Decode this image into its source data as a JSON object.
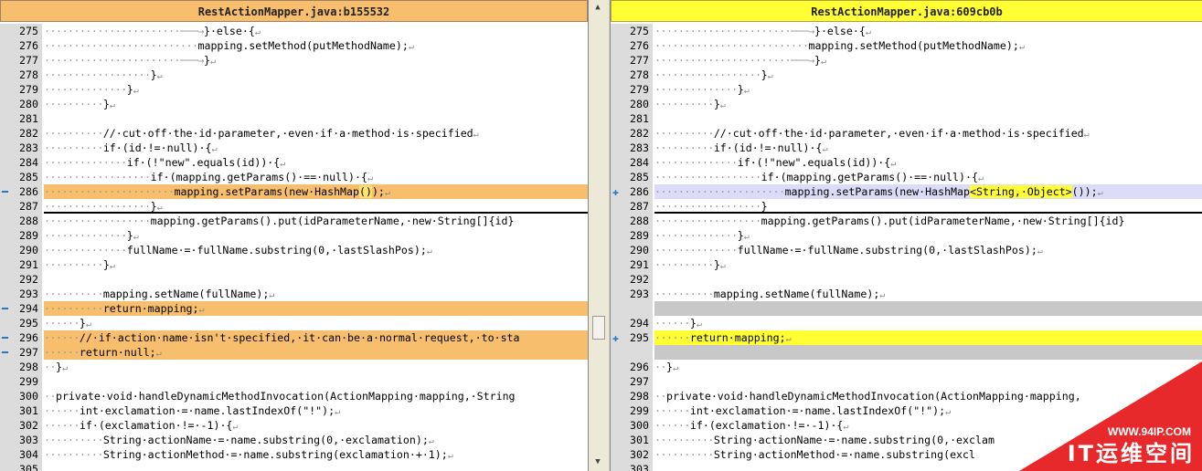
{
  "left": {
    "title": "RestActionMapper.java:b155532",
    "rows": [
      {
        "n": "275",
        "d": "·······················───→",
        "t": "}·else·{",
        "r": "↵",
        "s": "",
        "m": ""
      },
      {
        "n": "276",
        "d": "··························",
        "t": "mapping.setMethod(putMethodName);",
        "r": "↵",
        "s": "",
        "m": ""
      },
      {
        "n": "277",
        "d": "·······················───→",
        "t": "}",
        "r": "↵",
        "s": "",
        "m": ""
      },
      {
        "n": "278",
        "d": "··················",
        "t": "}",
        "r": "↵",
        "s": "",
        "m": ""
      },
      {
        "n": "279",
        "d": "··············",
        "t": "}",
        "r": "↵",
        "s": "",
        "m": ""
      },
      {
        "n": "280",
        "d": "··········",
        "t": "}",
        "r": "↵",
        "s": "",
        "m": ""
      },
      {
        "n": "281",
        "d": "",
        "t": "",
        "r": "",
        "s": "",
        "m": ""
      },
      {
        "n": "282",
        "d": "··········",
        "t": "//·cut·off·the·id·parameter,·even·if·a·method·is·specified",
        "r": "↵",
        "s": "",
        "m": ""
      },
      {
        "n": "283",
        "d": "··········",
        "t": "if·(id·!=·null)·{",
        "r": "↵",
        "s": "",
        "m": ""
      },
      {
        "n": "284",
        "d": "··············",
        "t": "if·(!\"new\".equals(id))·{",
        "r": "↵",
        "s": "",
        "m": ""
      },
      {
        "n": "285",
        "d": "··················",
        "t": "if·(mapping.getParams()·==·null)·{",
        "r": "↵",
        "s": "",
        "m": ""
      },
      {
        "n": "286",
        "d": "······················",
        "t": "mapping.setParams(new·HashMap",
        "h": "()",
        "t2": ");",
        "r": "↵",
        "s": "orange",
        "m": "━"
      },
      {
        "n": "287",
        "d": "··················",
        "t": "}",
        "r": "↵",
        "s": "",
        "m": "",
        "b": "1"
      },
      {
        "n": "288",
        "d": "··················",
        "t": "mapping.getParams().put(idParameterName,·new·String[]{id}",
        "r": "",
        "s": "",
        "m": ""
      },
      {
        "n": "289",
        "d": "··············",
        "t": "}",
        "r": "↵",
        "s": "",
        "m": ""
      },
      {
        "n": "290",
        "d": "··············",
        "t": "fullName·=·fullName.substring(0,·lastSlashPos);",
        "r": "↵",
        "s": "",
        "m": ""
      },
      {
        "n": "291",
        "d": "··········",
        "t": "}",
        "r": "↵",
        "s": "",
        "m": ""
      },
      {
        "n": "292",
        "d": "",
        "t": "",
        "r": "",
        "s": "",
        "m": ""
      },
      {
        "n": "293",
        "d": "··········",
        "t": "mapping.setName(fullName);",
        "r": "↵",
        "s": "",
        "m": ""
      },
      {
        "n": "294",
        "d": "··········",
        "t": "return·mapping;",
        "r": "↵",
        "s": "orange",
        "m": "━"
      },
      {
        "n": "295",
        "d": "······",
        "t": "}",
        "r": "↵",
        "s": "",
        "m": ""
      },
      {
        "n": "296",
        "d": "······",
        "t": "//·if·action·name·isn't·specified,·it·can·be·a·normal·request,·to·sta",
        "r": "",
        "s": "orange",
        "m": "━"
      },
      {
        "n": "297",
        "d": "······",
        "t": "return·null;",
        "r": "↵",
        "s": "orange",
        "m": "━"
      },
      {
        "n": "298",
        "d": "··",
        "t": "}",
        "r": "↵",
        "s": "",
        "m": ""
      },
      {
        "n": "299",
        "d": "",
        "t": "",
        "r": "",
        "s": "",
        "m": ""
      },
      {
        "n": "300",
        "d": "··",
        "t": "private·void·handleDynamicMethodInvocation(ActionMapping·mapping,·String",
        "r": "",
        "s": "",
        "m": ""
      },
      {
        "n": "301",
        "d": "······",
        "t": "int·exclamation·=·name.lastIndexOf(\"!\");",
        "r": "↵",
        "s": "",
        "m": ""
      },
      {
        "n": "302",
        "d": "······",
        "t": "if·(exclamation·!=·-1)·{",
        "r": "↵",
        "s": "",
        "m": ""
      },
      {
        "n": "303",
        "d": "··········",
        "t": "String·actionName·=·name.substring(0,·exclamation);",
        "r": "↵",
        "s": "",
        "m": ""
      },
      {
        "n": "304",
        "d": "··········",
        "t": "String·actionMethod·=·name.substring(exclamation·+·1);",
        "r": "↵",
        "s": "",
        "m": ""
      },
      {
        "n": "305",
        "d": "",
        "t": "",
        "r": "",
        "s": "",
        "m": ""
      }
    ]
  },
  "right": {
    "title": "RestActionMapper.java:609cb0b",
    "rows": [
      {
        "n": "275",
        "d": "·······················───→",
        "t": "}·else·{",
        "r": "↵",
        "s": "",
        "m": ""
      },
      {
        "n": "276",
        "d": "··························",
        "t": "mapping.setMethod(putMethodName);",
        "r": "↵",
        "s": "",
        "m": ""
      },
      {
        "n": "277",
        "d": "·······················───→",
        "t": "}",
        "r": "↵",
        "s": "",
        "m": ""
      },
      {
        "n": "278",
        "d": "··················",
        "t": "}",
        "r": "↵",
        "s": "",
        "m": ""
      },
      {
        "n": "279",
        "d": "··············",
        "t": "}",
        "r": "↵",
        "s": "",
        "m": ""
      },
      {
        "n": "280",
        "d": "··········",
        "t": "}",
        "r": "↵",
        "s": "",
        "m": ""
      },
      {
        "n": "281",
        "d": "",
        "t": "",
        "r": "",
        "s": "",
        "m": ""
      },
      {
        "n": "282",
        "d": "··········",
        "t": "//·cut·off·the·id·parameter,·even·if·a·method·is·specified",
        "r": "↵",
        "s": "",
        "m": ""
      },
      {
        "n": "283",
        "d": "··········",
        "t": "if·(id·!=·null)·{",
        "r": "↵",
        "s": "",
        "m": ""
      },
      {
        "n": "284",
        "d": "··············",
        "t": "if·(!\"new\".equals(id))·{",
        "r": "↵",
        "s": "",
        "m": ""
      },
      {
        "n": "285",
        "d": "··················",
        "t": "if·(mapping.getParams()·==·null)·{",
        "r": "↵",
        "s": "",
        "m": ""
      },
      {
        "n": "286",
        "d": "······················",
        "t": "mapping.setParams(new·HashMap",
        "h2": "<String,·Object>",
        "t2": "());",
        "r": "↵",
        "s": "lavender",
        "m": "✚"
      },
      {
        "n": "287",
        "d": "··················",
        "t": "}",
        "r": "",
        "s": "",
        "m": "",
        "b": "1"
      },
      {
        "n": "288",
        "d": "··················",
        "t": "mapping.getParams().put(idParameterName,·new·String[]{id}",
        "r": "",
        "s": "",
        "m": ""
      },
      {
        "n": "289",
        "d": "··············",
        "t": "}",
        "r": "↵",
        "s": "",
        "m": ""
      },
      {
        "n": "290",
        "d": "··············",
        "t": "fullName·=·fullName.substring(0,·lastSlashPos);",
        "r": "↵",
        "s": "",
        "m": ""
      },
      {
        "n": "291",
        "d": "··········",
        "t": "}",
        "r": "↵",
        "s": "",
        "m": ""
      },
      {
        "n": "292",
        "d": "",
        "t": "",
        "r": "",
        "s": "",
        "m": ""
      },
      {
        "n": "293",
        "d": "··········",
        "t": "mapping.setName(fullName);",
        "r": "↵",
        "s": "",
        "m": ""
      },
      {
        "n": "",
        "d": "",
        "t": "",
        "r": "",
        "s": "gray",
        "m": ""
      },
      {
        "n": "294",
        "d": "······",
        "t": "}",
        "r": "↵",
        "s": "",
        "m": ""
      },
      {
        "n": "295",
        "d": "······",
        "t": "return·mapping;",
        "r": "↵",
        "s": "yellow",
        "m": "✚"
      },
      {
        "n": "",
        "d": "",
        "t": "",
        "r": "",
        "s": "gray",
        "m": ""
      },
      {
        "n": "296",
        "d": "··",
        "t": "}",
        "r": "↵",
        "s": "",
        "m": ""
      },
      {
        "n": "297",
        "d": "",
        "t": "",
        "r": "",
        "s": "",
        "m": ""
      },
      {
        "n": "298",
        "d": "··",
        "t": "private·void·handleDynamicMethodInvocation(ActionMapping·mapping,",
        "r": "",
        "s": "",
        "m": ""
      },
      {
        "n": "299",
        "d": "······",
        "t": "int·exclamation·=·name.lastIndexOf(\"!\");",
        "r": "↵",
        "s": "",
        "m": ""
      },
      {
        "n": "300",
        "d": "······",
        "t": "if·(exclamation·!=·-1)·{",
        "r": "↵",
        "s": "",
        "m": ""
      },
      {
        "n": "301",
        "d": "··········",
        "t": "String·actionName·=·name.substring(0,·exclam",
        "r": "",
        "s": "",
        "m": ""
      },
      {
        "n": "302",
        "d": "··········",
        "t": "String·actionMethod·=·name.substring(excl",
        "r": "",
        "s": "",
        "m": ""
      },
      {
        "n": "303",
        "d": "",
        "t": "",
        "r": "",
        "s": "",
        "m": ""
      }
    ]
  },
  "watermark": {
    "url": "WWW.94IP.COM",
    "brand": "IT运维空间"
  },
  "splitter": {
    "up_arrow": "▲",
    "down_arrow": "▼"
  }
}
